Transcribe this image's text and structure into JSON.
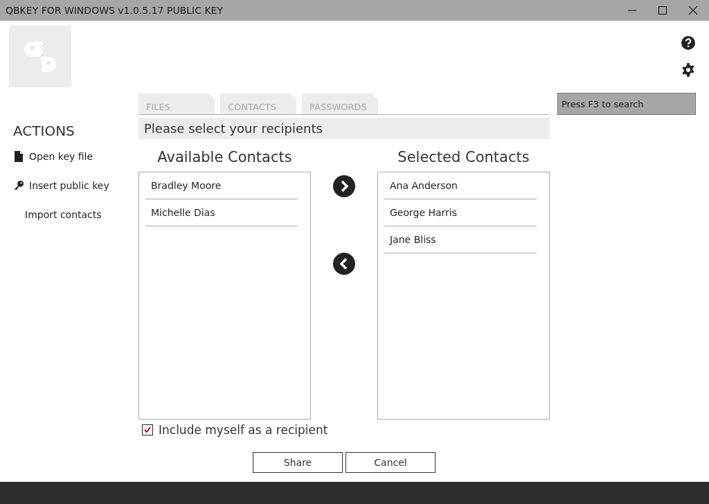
{
  "window": {
    "title": "QBKEY FOR WINDOWS v1.0.5.17  PUBLIC KEY"
  },
  "sidebar": {
    "heading": "ACTIONS",
    "items": [
      {
        "label": "Open key file",
        "kind": "file"
      },
      {
        "label": "Insert public key",
        "kind": "key"
      },
      {
        "label": "Import contacts",
        "kind": "plain"
      }
    ]
  },
  "tabs": [
    {
      "label": "FILES"
    },
    {
      "label": "CONTACTS"
    },
    {
      "label": "PASSWORDS"
    }
  ],
  "search": {
    "placeholder": "Press F3 to search"
  },
  "header": "Please select your recipients",
  "available": {
    "title": "Available Contacts",
    "items": [
      "Bradley Moore",
      "Michelle Dias"
    ]
  },
  "selected": {
    "title": "Selected Contacts",
    "items": [
      "Ana Anderson",
      "George Harris",
      "Jane Bliss"
    ]
  },
  "include_myself": {
    "label": "Include myself as a recipient",
    "checked": true
  },
  "buttons": [
    "Share",
    "Cancel"
  ]
}
